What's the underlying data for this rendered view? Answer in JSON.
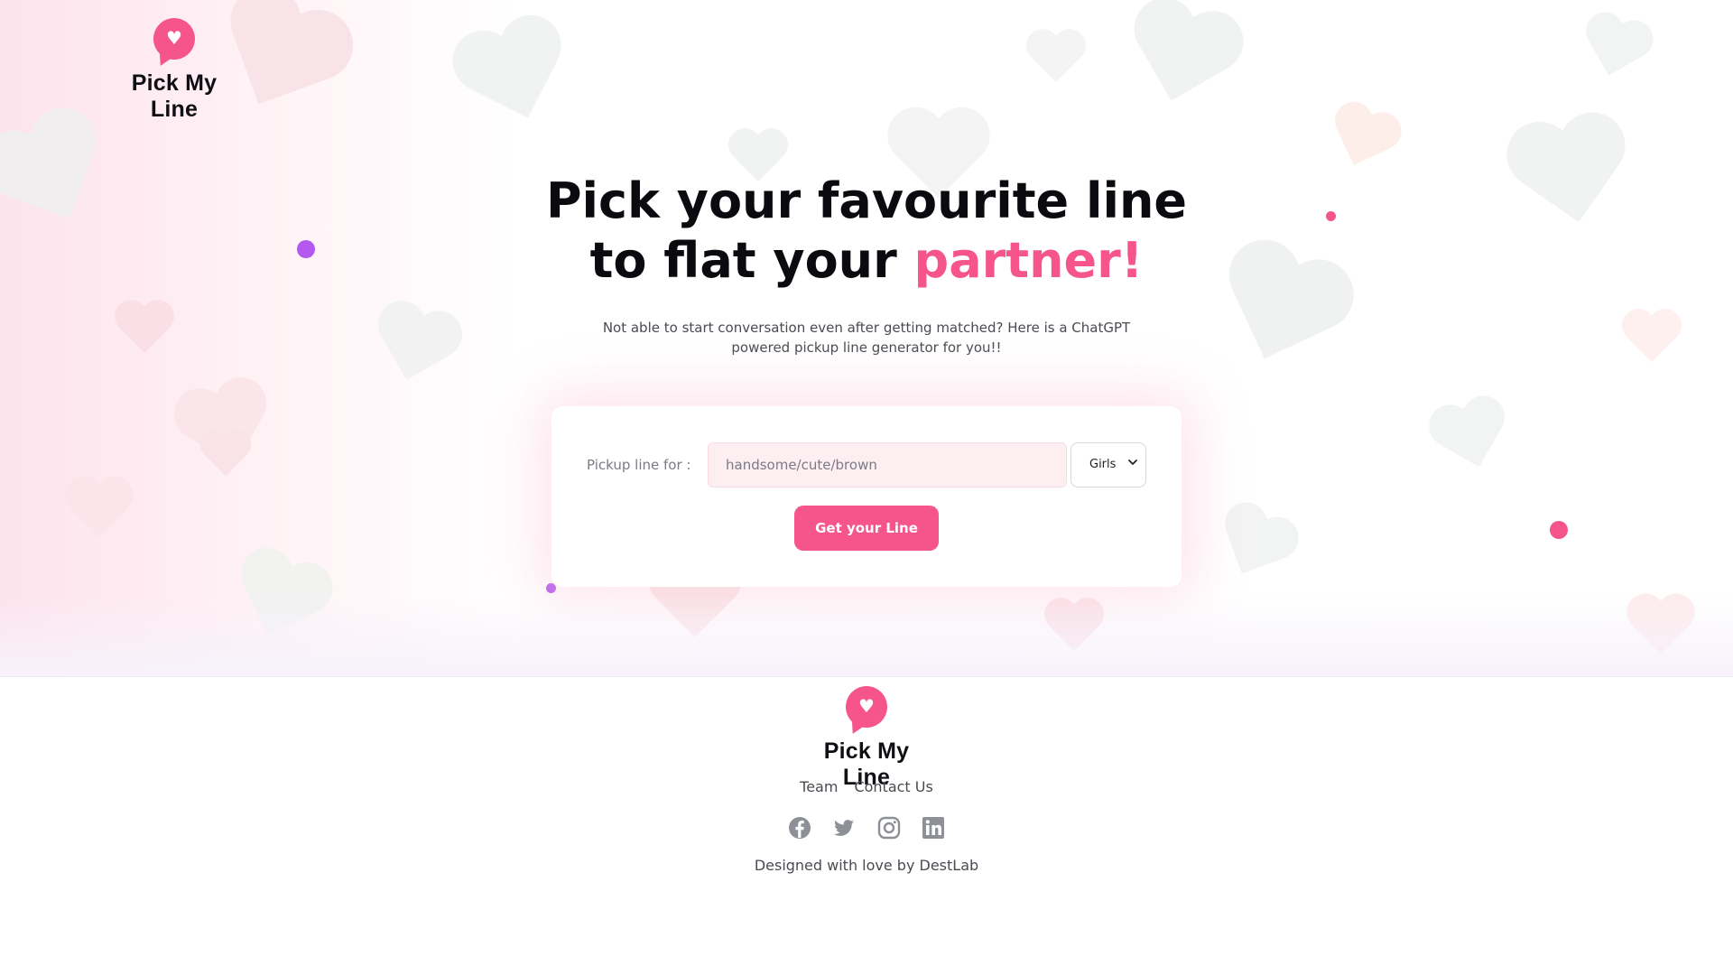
{
  "brand": {
    "name": "Pick My Line",
    "logo_icon": "heart-pin-icon",
    "accent_color": "#f5558b",
    "purple_accent": "#b458f0"
  },
  "hero": {
    "headline_line1": "Pick your favourite line",
    "headline_line2_prefix": "to flat your ",
    "headline_line2_accent": "partner!",
    "subtitle_line1": "Not able to start conversation even after getting matched? Here is a ChatGPT",
    "subtitle_line2": "powered pickup line generator for you!!"
  },
  "form": {
    "label": "Pickup line for :",
    "input_value": "",
    "input_placeholder": "handsome/cute/brown",
    "select_value": "Girls",
    "submit_label": "Get your Line"
  },
  "footer": {
    "brand_name": "Pick My Line",
    "links": [
      "Team",
      "Contact Us"
    ],
    "socials": [
      "facebook-icon",
      "twitter-icon",
      "instagram-icon",
      "linkedin-icon"
    ],
    "credit": "Designed with love by DestLab"
  }
}
